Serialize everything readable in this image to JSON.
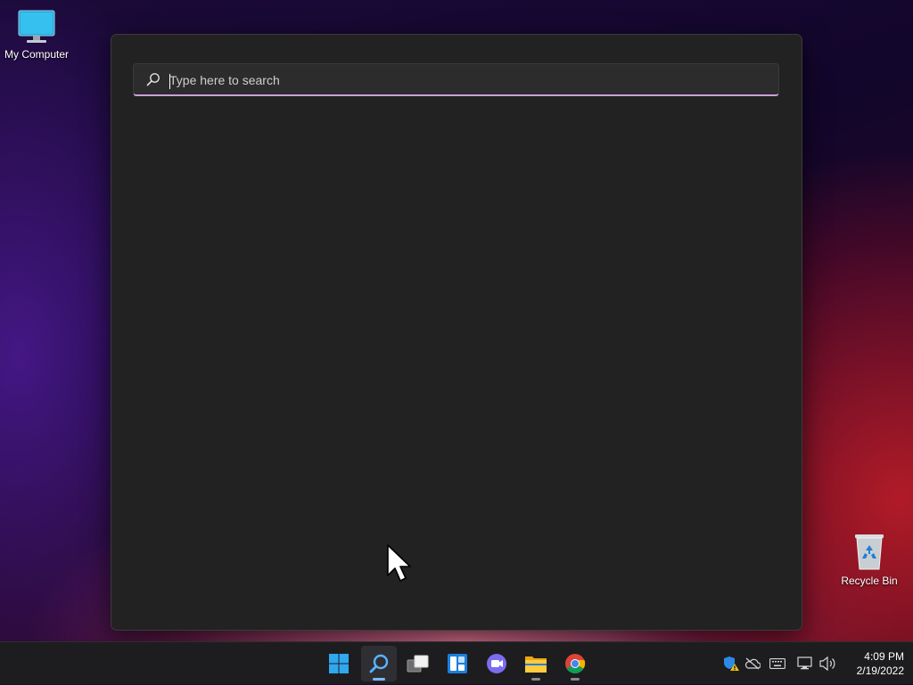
{
  "desktop": {
    "icons": [
      {
        "label": "My Computer",
        "icon": "monitor-icon"
      },
      {
        "label": "Recycle Bin",
        "icon": "recycle-bin-icon"
      }
    ]
  },
  "search": {
    "placeholder": "Type here to search",
    "value": "",
    "icon": "search-icon",
    "accent_color": "#c9a0dc"
  },
  "taskbar": {
    "apps": [
      {
        "name": "Start",
        "icon": "windows-start-icon"
      },
      {
        "name": "Search",
        "icon": "search-icon",
        "active": true
      },
      {
        "name": "Task View",
        "icon": "task-view-icon"
      },
      {
        "name": "Widgets",
        "icon": "widgets-icon"
      },
      {
        "name": "Chat",
        "icon": "chat-icon"
      },
      {
        "name": "File Explorer",
        "icon": "folder-icon"
      },
      {
        "name": "Google Chrome",
        "icon": "chrome-icon"
      }
    ],
    "tray": {
      "icons": [
        "security-warning-icon",
        "onedrive-offline-icon",
        "keyboard-icon",
        "network-icon",
        "volume-icon"
      ],
      "time": "4:09 PM",
      "date": "2/19/2022"
    }
  }
}
